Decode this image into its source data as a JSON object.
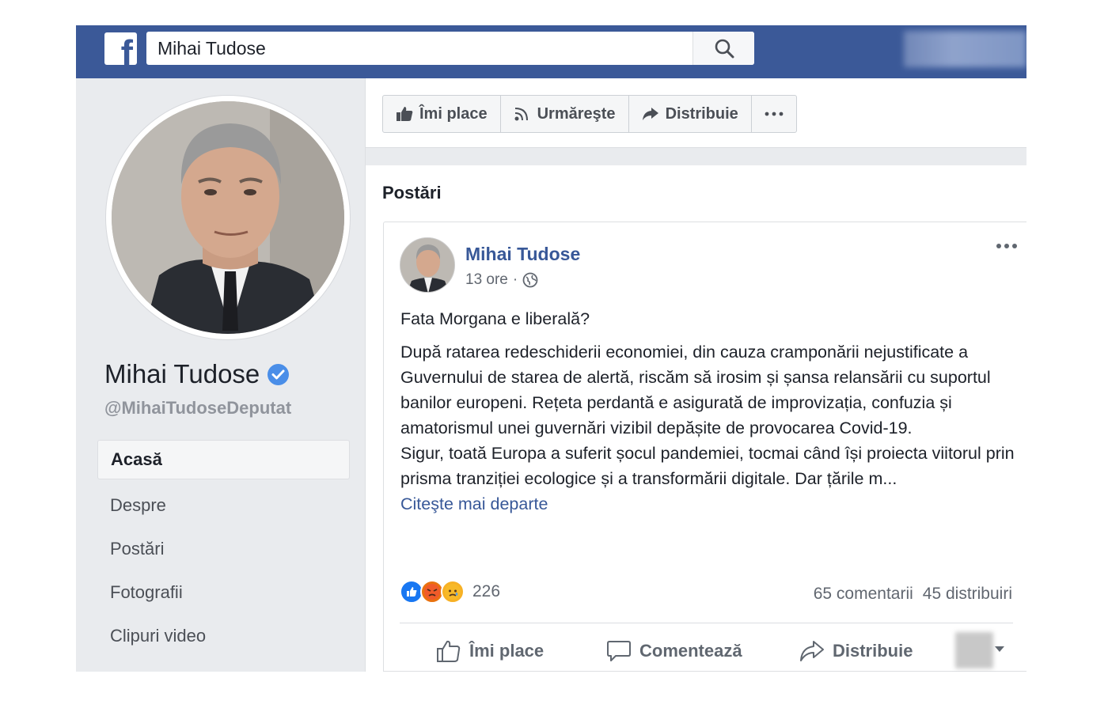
{
  "topbar": {
    "search_value": "Mihai Tudose",
    "logo": "f"
  },
  "profile": {
    "name": "Mihai Tudose",
    "handle": "@MihaiTudoseDeputat",
    "verified": true
  },
  "nav": {
    "items": [
      {
        "label": "Acasă",
        "active": true
      },
      {
        "label": "Despre"
      },
      {
        "label": "Postări"
      },
      {
        "label": "Fotografii"
      },
      {
        "label": "Clipuri video"
      }
    ]
  },
  "page_actions": {
    "like": "Îmi place",
    "follow": "Urmăreşte",
    "share": "Distribuie"
  },
  "posts": {
    "header": "Postări",
    "post": {
      "author": "Mihai Tudose",
      "time": "13 ore",
      "separator": "·",
      "title_line": "Fata Morgana e liberală?",
      "paragraph_1": "După ratarea redeschiderii economiei, din cauza cramponării nejustificate a Guvernului de starea de alertă, riscăm să irosim și șansa relansării cu suportul banilor europeni. Rețeta perdantă e asigurată de improvizația, confuzia și amatorismul unei guvernări vizibil depășite de provocarea Covid-19.",
      "paragraph_2": "Sigur, toată Europa a suferit șocul pandemiei, tocmai când își proiecta viitorul prin prisma tranziției ecologice și a transformării digitale. Dar țările m...",
      "read_more": "Citeşte mai departe",
      "reaction_count": "226",
      "comments": "65 comentarii",
      "shares": "45 distribuiri",
      "actions": {
        "like": "Îmi place",
        "comment": "Comentează",
        "share": "Distribuie"
      }
    }
  },
  "colors": {
    "brand": "#3b5998",
    "link": "#385898",
    "background": "#e9ebee"
  }
}
